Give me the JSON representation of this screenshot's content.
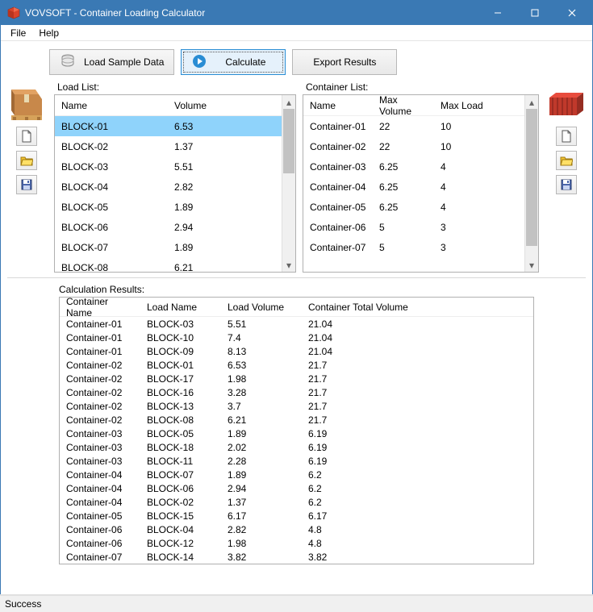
{
  "window": {
    "title": "VOVSOFT - Container Loading Calculator",
    "controls": {
      "min": "—",
      "max": "▢",
      "close": "✕"
    }
  },
  "menu": {
    "file": "File",
    "help": "Help"
  },
  "toolbar": {
    "load_sample": "Load Sample Data",
    "calculate": "Calculate",
    "export": "Export Results"
  },
  "load_list": {
    "label": "Load List:",
    "cols": {
      "name": "Name",
      "volume": "Volume"
    },
    "rows": [
      {
        "name": "BLOCK-01",
        "volume": "6.53"
      },
      {
        "name": "BLOCK-02",
        "volume": "1.37"
      },
      {
        "name": "BLOCK-03",
        "volume": "5.51"
      },
      {
        "name": "BLOCK-04",
        "volume": "2.82"
      },
      {
        "name": "BLOCK-05",
        "volume": "1.89"
      },
      {
        "name": "BLOCK-06",
        "volume": "2.94"
      },
      {
        "name": "BLOCK-07",
        "volume": "1.89"
      },
      {
        "name": "BLOCK-08",
        "volume": "6.21"
      }
    ],
    "selected_index": 0
  },
  "container_list": {
    "label": "Container List:",
    "cols": {
      "name": "Name",
      "maxv": "Max Volume",
      "maxl": "Max Load"
    },
    "rows": [
      {
        "name": "Container-01",
        "maxv": "22",
        "maxl": "10"
      },
      {
        "name": "Container-02",
        "maxv": "22",
        "maxl": "10"
      },
      {
        "name": "Container-03",
        "maxv": "6.25",
        "maxl": "4"
      },
      {
        "name": "Container-04",
        "maxv": "6.25",
        "maxl": "4"
      },
      {
        "name": "Container-05",
        "maxv": "6.25",
        "maxl": "4"
      },
      {
        "name": "Container-06",
        "maxv": "5",
        "maxl": "3"
      },
      {
        "name": "Container-07",
        "maxv": "5",
        "maxl": "3"
      }
    ]
  },
  "results": {
    "label": "Calculation Results:",
    "cols": {
      "cn": "Container Name",
      "ln": "Load Name",
      "lv": "Load Volume",
      "ctv": "Container Total Volume"
    },
    "rows": [
      {
        "cn": "Container-01",
        "ln": "BLOCK-03",
        "lv": "5.51",
        "ctv": "21.04"
      },
      {
        "cn": "Container-01",
        "ln": "BLOCK-10",
        "lv": "7.4",
        "ctv": "21.04"
      },
      {
        "cn": "Container-01",
        "ln": "BLOCK-09",
        "lv": "8.13",
        "ctv": "21.04"
      },
      {
        "cn": "Container-02",
        "ln": "BLOCK-01",
        "lv": "6.53",
        "ctv": "21.7"
      },
      {
        "cn": "Container-02",
        "ln": "BLOCK-17",
        "lv": "1.98",
        "ctv": "21.7"
      },
      {
        "cn": "Container-02",
        "ln": "BLOCK-16",
        "lv": "3.28",
        "ctv": "21.7"
      },
      {
        "cn": "Container-02",
        "ln": "BLOCK-13",
        "lv": "3.7",
        "ctv": "21.7"
      },
      {
        "cn": "Container-02",
        "ln": "BLOCK-08",
        "lv": "6.21",
        "ctv": "21.7"
      },
      {
        "cn": "Container-03",
        "ln": "BLOCK-05",
        "lv": "1.89",
        "ctv": "6.19"
      },
      {
        "cn": "Container-03",
        "ln": "BLOCK-18",
        "lv": "2.02",
        "ctv": "6.19"
      },
      {
        "cn": "Container-03",
        "ln": "BLOCK-11",
        "lv": "2.28",
        "ctv": "6.19"
      },
      {
        "cn": "Container-04",
        "ln": "BLOCK-07",
        "lv": "1.89",
        "ctv": "6.2"
      },
      {
        "cn": "Container-04",
        "ln": "BLOCK-06",
        "lv": "2.94",
        "ctv": "6.2"
      },
      {
        "cn": "Container-04",
        "ln": "BLOCK-02",
        "lv": "1.37",
        "ctv": "6.2"
      },
      {
        "cn": "Container-05",
        "ln": "BLOCK-15",
        "lv": "6.17",
        "ctv": "6.17"
      },
      {
        "cn": "Container-06",
        "ln": "BLOCK-04",
        "lv": "2.82",
        "ctv": "4.8"
      },
      {
        "cn": "Container-06",
        "ln": "BLOCK-12",
        "lv": "1.98",
        "ctv": "4.8"
      },
      {
        "cn": "Container-07",
        "ln": "BLOCK-14",
        "lv": "3.82",
        "ctv": "3.82"
      }
    ]
  },
  "status": "Success",
  "icons": {
    "new": "new-file-icon",
    "open": "open-folder-icon",
    "save": "save-disk-icon",
    "db": "database-icon",
    "calc": "play-circle-icon",
    "export": "export-icon",
    "box": "pallet-box-icon",
    "container": "shipping-container-icon"
  }
}
